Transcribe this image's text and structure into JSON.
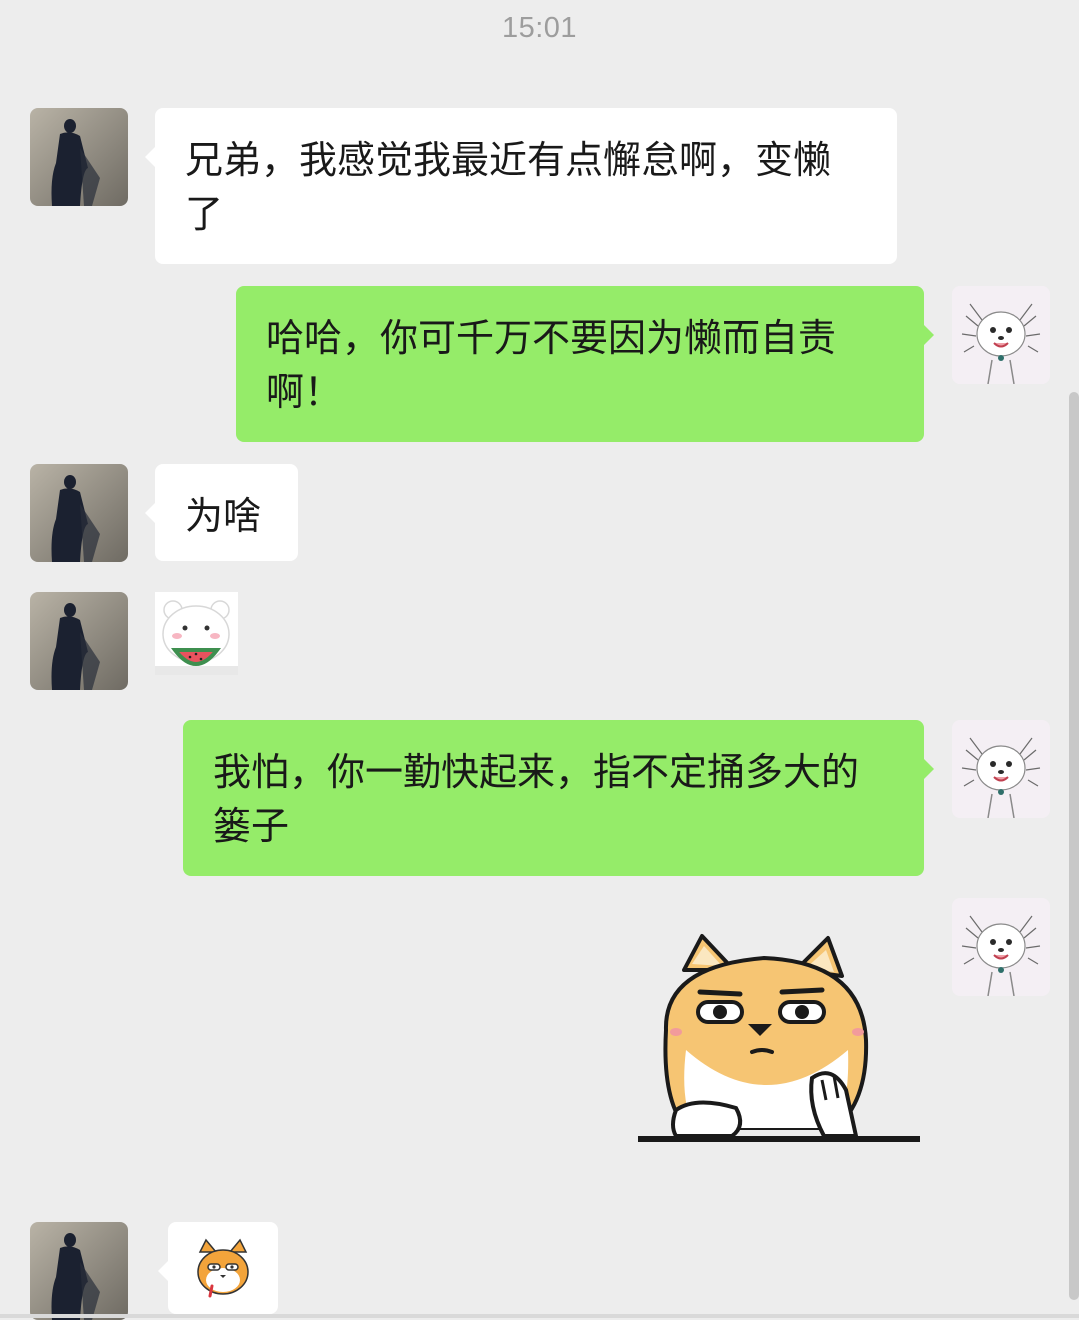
{
  "chat": {
    "timestamp": "15:01",
    "messages": [
      {
        "side": "left",
        "type": "text",
        "text": "兄弟，我感觉我最近有点懈怠啊，变懒了"
      },
      {
        "side": "right",
        "type": "text",
        "text": "哈哈，你可千万不要因为懒而自责啊！"
      },
      {
        "side": "left",
        "type": "text",
        "text": "为啥"
      },
      {
        "side": "left",
        "type": "sticker",
        "sticker": "bear-eating-watermelon-sticker"
      },
      {
        "side": "right",
        "type": "text",
        "text": "我怕，你一勤快起来，指不定捅多大的篓子"
      },
      {
        "side": "right",
        "type": "sticker",
        "sticker": "shiba-dog-smirk-sticker"
      },
      {
        "side": "left",
        "type": "sticker",
        "sticker": "small-shiba-emoji-sticker"
      }
    ]
  },
  "colors": {
    "background": "#ededed",
    "incoming_bubble": "#ffffff",
    "outgoing_bubble": "#95ec69",
    "timestamp_text": "#9d9d9d"
  }
}
